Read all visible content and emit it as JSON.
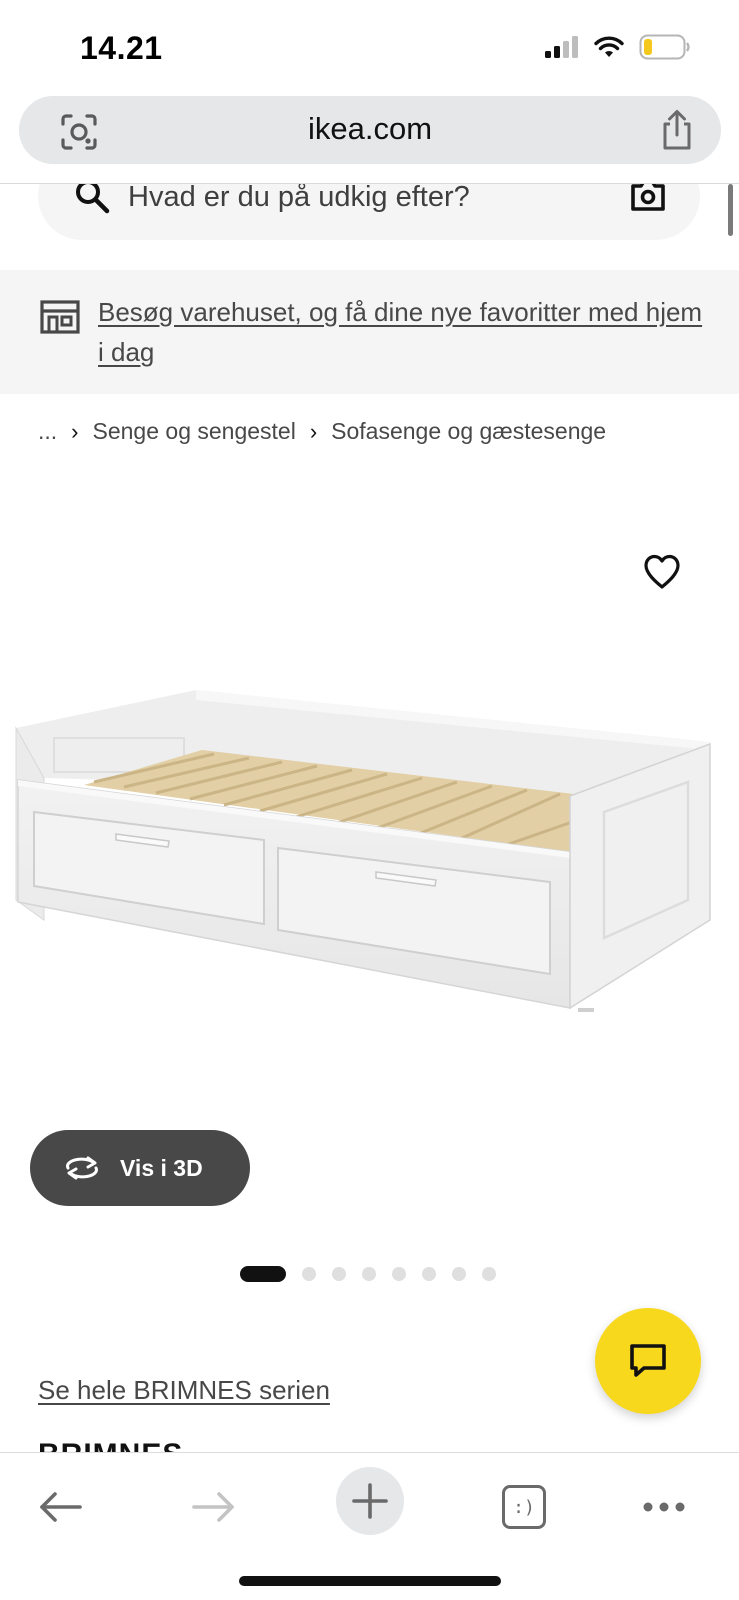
{
  "status_bar": {
    "time": "14.21",
    "battery_color": "#f4c81c"
  },
  "browser": {
    "url": "ikea.com",
    "lens_icon": "camera-search-icon",
    "share_icon": "share-icon"
  },
  "site_search": {
    "placeholder": "Hvad er du på udkig efter?",
    "search_icon": "magnifier-icon",
    "camera_icon": "camera-icon"
  },
  "store_banner": {
    "icon": "store-icon",
    "link_text": "Besøg varehuset, og få dine nye favoritter med hjem i dag"
  },
  "breadcrumb": {
    "items": [
      "...",
      "Senge og sengestel",
      "Sofasenge og gæstesenge"
    ]
  },
  "product": {
    "favourite_icon": "heart-icon",
    "image_alt": "white daybed with two drawers and wooden slats",
    "view_3d_label": "Vis i 3D",
    "carousel": {
      "total": 8,
      "active_index": 1
    },
    "series_link": "Se hele BRIMNES serien",
    "name": "BRIMNES"
  },
  "chat": {
    "icon": "chat-bubble-icon",
    "color": "#f8d81c"
  },
  "toolbar": {
    "back_icon": "arrow-left-icon",
    "forward_icon": "arrow-right-icon",
    "new_tab_icon": "plus-icon",
    "tabs_label": ":)",
    "more_icon": "more-dots-icon"
  },
  "colors": {
    "text_primary": "#111111",
    "text_secondary": "#484848",
    "banner_bg": "#f5f5f5",
    "address_bar_bg": "#e6e7e9",
    "button_dark": "#484848"
  }
}
